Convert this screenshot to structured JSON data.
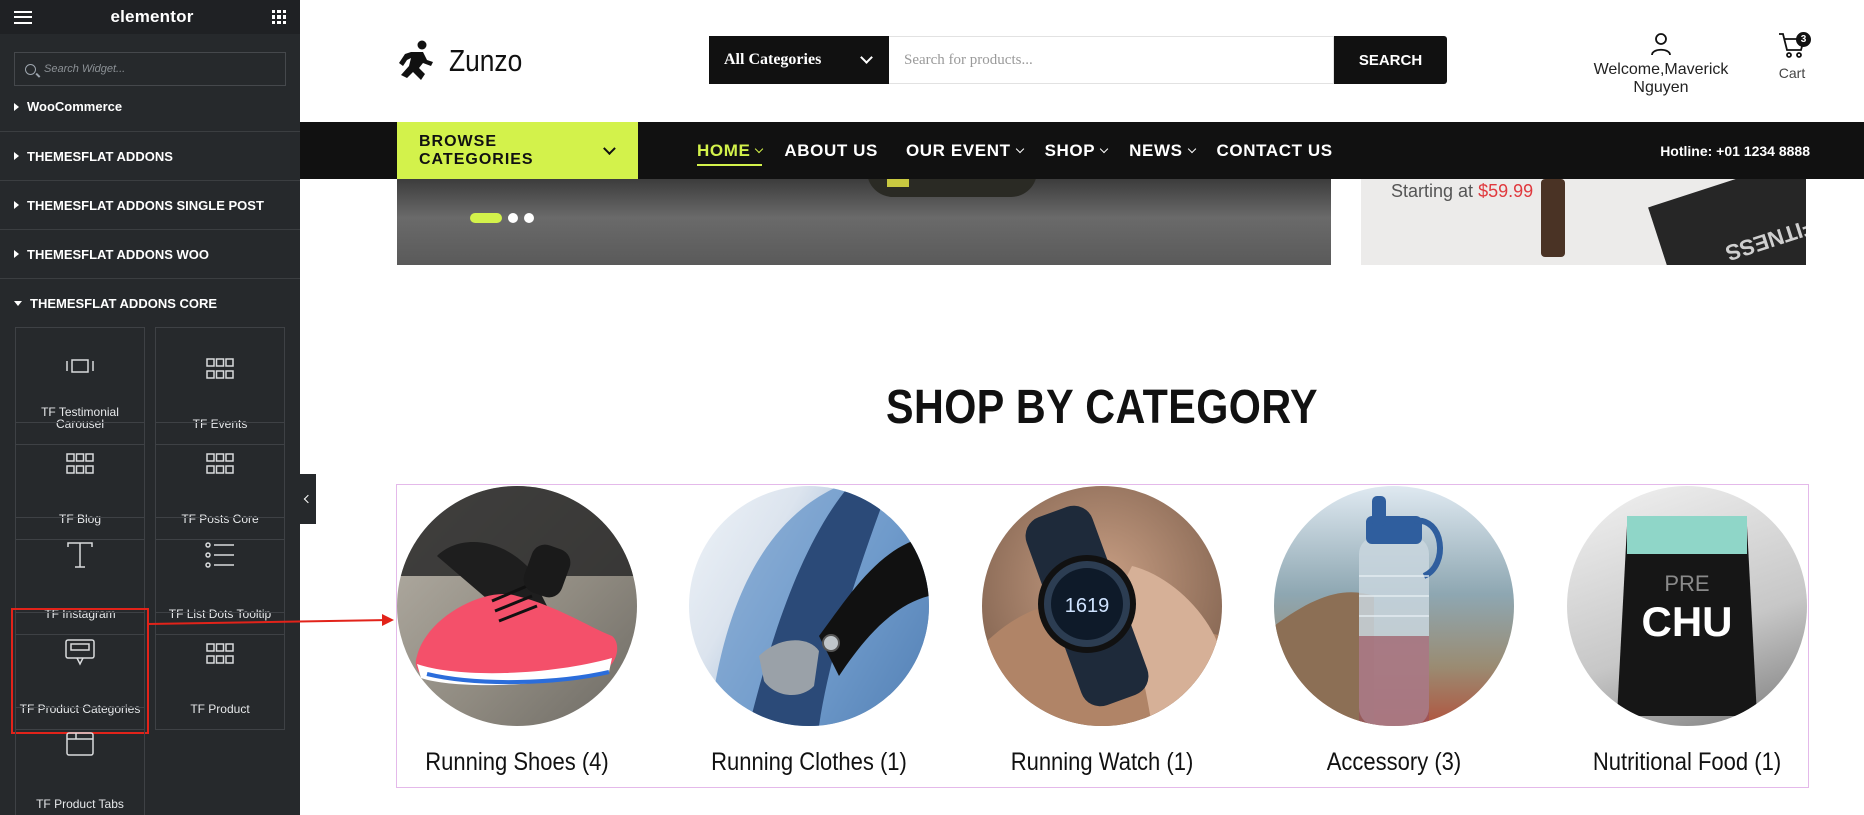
{
  "editor": {
    "brand": "elementor",
    "search_placeholder": "Search Widget...",
    "categories": [
      "WooCommerce",
      "THEMESFLAT ADDONS",
      "THEMESFLAT ADDONS SINGLE POST",
      "THEMESFLAT ADDONS WOO",
      "THEMESFLAT ADDONS CORE"
    ],
    "widgets": [
      {
        "label": "TF Testimonial Carousel",
        "icon": "carousel-icon"
      },
      {
        "label": "TF Events",
        "icon": "grid-icon"
      },
      {
        "label": "TF Blog",
        "icon": "grid-icon"
      },
      {
        "label": "TF Posts Core",
        "icon": "grid-icon"
      },
      {
        "label": "TF Instagram",
        "icon": "text-T-icon"
      },
      {
        "label": "TF List Dots Tooltip",
        "icon": "list-icon"
      },
      {
        "label": "TF Product Categories",
        "icon": "product-categories-icon",
        "highlighted": true
      },
      {
        "label": "TF Product",
        "icon": "grid-icon"
      },
      {
        "label": "TF Product Tabs",
        "icon": "product-tabs-icon"
      }
    ]
  },
  "site": {
    "logo_text": "Zunzo",
    "category_select": "All Categories",
    "search_placeholder": "Search for products...",
    "search_button": "SEARCH",
    "account_text": "Welcome,Maverick Nguyen",
    "cart_label": "Cart",
    "cart_count": "3",
    "browse_categories": "BROWSE CATEGORIES",
    "menu": [
      {
        "label": "HOME",
        "active": true,
        "dropdown": true
      },
      {
        "label": "ABOUT US",
        "active": false,
        "dropdown": false
      },
      {
        "label": "OUR EVENT",
        "active": false,
        "dropdown": true
      },
      {
        "label": "SHOP",
        "active": false,
        "dropdown": true
      },
      {
        "label": "NEWS",
        "active": false,
        "dropdown": true
      },
      {
        "label": "CONTACT US",
        "active": false,
        "dropdown": false
      }
    ],
    "hotline": "Hotline: +01 1234 8888",
    "banner_right_prefix": "Starting at",
    "banner_right_price": "$59.99",
    "banner_right_mat_text": "FITNESS"
  },
  "shop": {
    "heading": "SHOP BY CATEGORY",
    "categories": [
      {
        "label": "Running Shoes (4)"
      },
      {
        "label": "Running Clothes (1)"
      },
      {
        "label": "Running Watch (1)"
      },
      {
        "label": "Accessory (3)"
      },
      {
        "label": "Nutritional Food (1)"
      }
    ],
    "watch_face": "1619",
    "pouch_brand": "CHU",
    "pouch_top": "PRE"
  },
  "colors": {
    "accent": "#d3f24b",
    "dark": "#111111",
    "panel": "#26292c",
    "highlight": "#e2231a",
    "price": "#e0393e"
  }
}
